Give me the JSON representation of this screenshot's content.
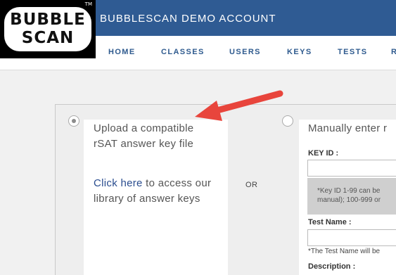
{
  "header": {
    "account_title": "BUBBLESCAN DEMO ACCOUNT",
    "brand_color": "#2f5b93"
  },
  "logo": {
    "line1": "BUBBLE",
    "line2": "SCAN",
    "trademark": "TM"
  },
  "nav": {
    "items": [
      {
        "label": "HOME"
      },
      {
        "label": "CLASSES"
      },
      {
        "label": "USERS"
      },
      {
        "label": "KEYS"
      },
      {
        "label": "TESTS"
      },
      {
        "label": "R"
      }
    ]
  },
  "upload_option": {
    "selected": true,
    "text": "Upload a compatible rSAT answer key file",
    "link_text": "Click here",
    "link_suffix": " to access our library of answer keys"
  },
  "separator": {
    "label": "OR"
  },
  "manual_option": {
    "selected": false,
    "title": "Manually enter r",
    "key_id_label": "KEY ID :",
    "key_id_value": "",
    "key_id_help_line1": "*Key ID 1-99 can be",
    "key_id_help_line2": "manual); 100-999 or",
    "test_name_label": "Test Name :",
    "test_name_value": "",
    "test_name_note": "*The Test Name will be",
    "description_label": "Description :"
  },
  "annotation": {
    "arrow_color": "#e8453c",
    "arrow_icon": "red-pointer-arrow-icon"
  }
}
